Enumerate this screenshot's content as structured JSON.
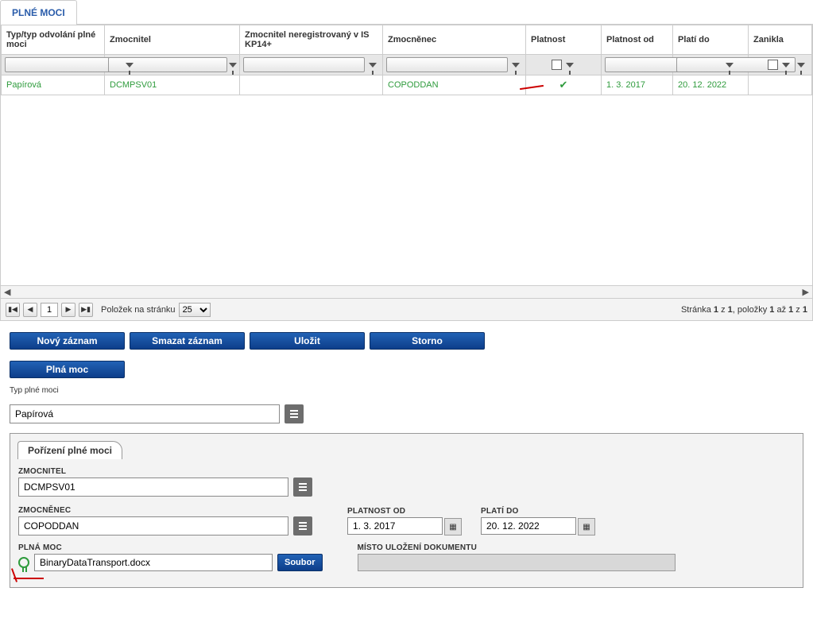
{
  "tabs": {
    "main": "PLNÉ MOCI"
  },
  "grid": {
    "headers": {
      "col1": "Typ/typ odvolání plné moci",
      "col2": "Zmocnitel",
      "col3": "Zmocnitel neregistrovaný v IS KP14+",
      "col4": "Zmocněnec",
      "col5": "Platnost",
      "col6": "Platnost od",
      "col7": "Platí do",
      "col8": "Zanikla"
    },
    "row1": {
      "type": "Papírová",
      "zmocnitel": "DCMPSV01",
      "unreg": "",
      "zmocnenec": "COPODDAN",
      "od": "1. 3. 2017",
      "do": "20. 12. 2022"
    }
  },
  "pager": {
    "page": "1",
    "itemsPerPageLabel": "Položek na stránku",
    "size": "25",
    "summary_prefix": "Stránka ",
    "summary_mid": " z ",
    "summary_items": ", položky ",
    "summary_to": " až ",
    "summary_of": " z ",
    "p1": "1",
    "p2": "1",
    "i1": "1",
    "i2": "1",
    "i3": "1"
  },
  "buttons": {
    "novy": "Nový záznam",
    "smazat": "Smazat záznam",
    "ulozit": "Uložit",
    "storno": "Storno",
    "plnamoc": "Plná moc",
    "soubor": "Soubor"
  },
  "form": {
    "typLabel": "Typ plné moci",
    "typValue": "Papírová",
    "fieldsetTab": "Pořízení plné moci",
    "zmocnitelLabel": "ZMOCNITEL",
    "zmocnitelValue": "DCMPSV01",
    "zmocnenecLabel": "ZMOCNĚNEC",
    "zmocnenecValue": "COPODDAN",
    "platnostOdLabel": "PLATNOST OD",
    "platnostOdValue": "1. 3. 2017",
    "platiDoLabel": "PLATÍ DO",
    "platiDoValue": "20. 12. 2022",
    "mistoLabel": "MÍSTO ULOŽENÍ DOKUMENTU",
    "plnaMocLabel": "PLNÁ MOC",
    "fileValue": "BinaryDataTransport.docx"
  }
}
